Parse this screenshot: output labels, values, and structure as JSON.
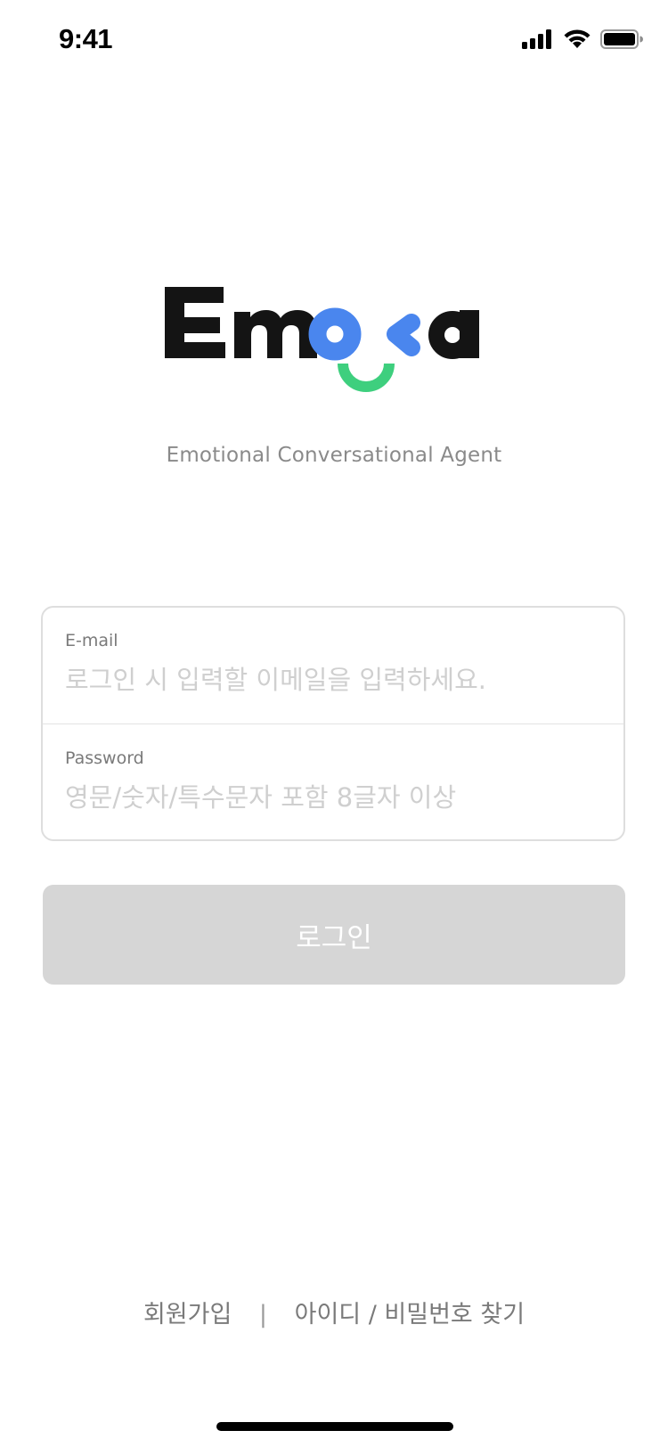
{
  "status_bar": {
    "time": "9:41",
    "icons": [
      "cellular-signal-icon",
      "wifi-icon",
      "battery-icon"
    ]
  },
  "brand": {
    "logo_text": "Emoca",
    "tagline": "Emotional Conversational Agent",
    "colors": {
      "dark": "#141414",
      "blue": "#4A86EE",
      "green": "#3ECF7E"
    }
  },
  "form": {
    "email": {
      "label": "E-mail",
      "placeholder": "로그인 시 입력할 이메일을 입력하세요.",
      "value": ""
    },
    "password": {
      "label": "Password",
      "placeholder": "영문/숫자/특수문자 포함 8글자 이상",
      "value": ""
    }
  },
  "login_button": {
    "label": "로그인",
    "color": "#D6D6D6"
  },
  "footer": {
    "signup": "회원가입",
    "separator": "|",
    "find_account": "아이디 / 비밀번호 찾기"
  }
}
